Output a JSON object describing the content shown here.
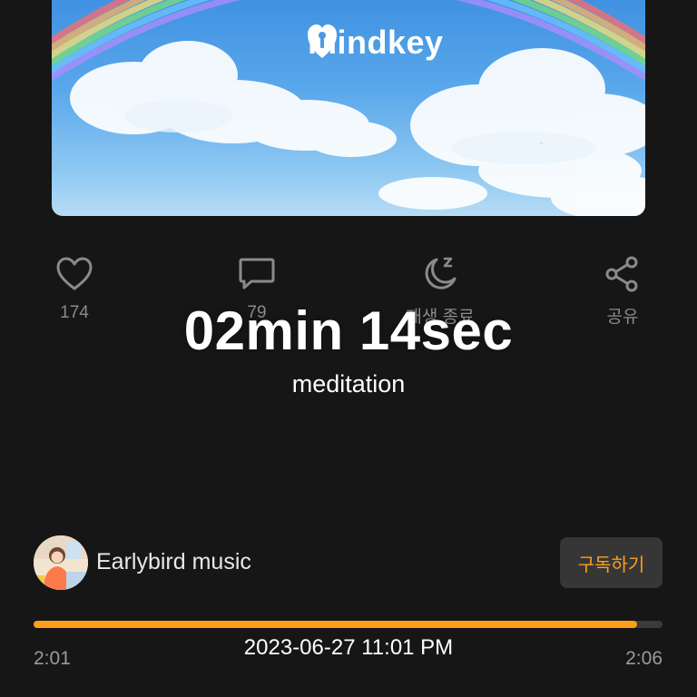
{
  "cover": {
    "brand": "mindkey"
  },
  "actions": [
    {
      "icon": "heart-icon",
      "label": "174"
    },
    {
      "icon": "comment-icon",
      "label": "79"
    },
    {
      "icon": "sleep-moon-icon",
      "label": "재생 종료"
    },
    {
      "icon": "share-icon",
      "label": "공유"
    }
  ],
  "overlay": {
    "duration": "02min 14sec",
    "category": "meditation"
  },
  "channel": {
    "name": "Earlybird music",
    "subscribe_label": "구독하기"
  },
  "player": {
    "elapsed": "2:01",
    "total": "2:06",
    "progress": 0.96
  },
  "timestamp": "2023-06-27 11:01 PM",
  "colors": {
    "background": "#161616",
    "accent": "#ff9e1b",
    "muted_text": "#8a8a8a"
  }
}
